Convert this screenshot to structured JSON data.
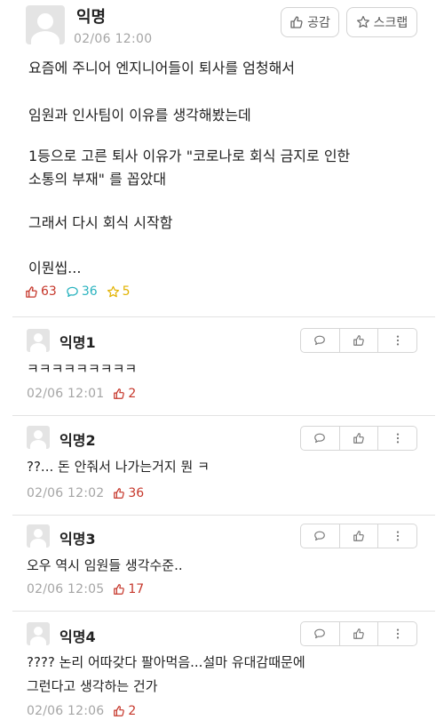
{
  "post": {
    "author": "익명",
    "time": "02/06 12:00",
    "like_button_label": "공감",
    "scrap_button_label": "스크랩",
    "lines": [
      "요즘에 주니어 엔지니어들이 퇴사를 엄청해서",
      "임원과 인사팀이 이유를 생각해봤는데",
      "1등으로 고른 퇴사 이유가 \"코로나로 회식 금지로 인한",
      "소통의 부재\" 를 꼽았대",
      "그래서 다시 회식 시작함",
      "이뭔씹..."
    ],
    "stats": {
      "likes": "63",
      "comments": "36",
      "scraps": "5"
    }
  },
  "comments": [
    {
      "author": "익명1",
      "lines": [
        "ㅋㅋㅋㅋㅋㅋㅋㅋㅋ"
      ],
      "time": "02/06 12:01",
      "likes": "2"
    },
    {
      "author": "익명2",
      "lines": [
        "??... 돈 안줘서 나가는거지 뭔 ㅋ"
      ],
      "time": "02/06 12:02",
      "likes": "36"
    },
    {
      "author": "익명3",
      "lines": [
        "오우 역시 임원들 생각수준.."
      ],
      "time": "02/06 12:05",
      "likes": "17"
    },
    {
      "author": "익명4",
      "lines": [
        "???? 논리 어따갖다 팔아먹음...설마 유대감때문에",
        "그런다고 생각하는 건가"
      ],
      "time": "02/06 12:06",
      "likes": "2"
    }
  ],
  "colors": {
    "like": "#c6372b",
    "comment": "#2ab3bf",
    "scrap": "#e2b200",
    "muted": "#a5a5a5"
  },
  "icons": {
    "like": "thumbs-up-icon",
    "comment": "speech-bubble-icon",
    "scrap": "star-icon",
    "more": "more-vertical-icon"
  }
}
